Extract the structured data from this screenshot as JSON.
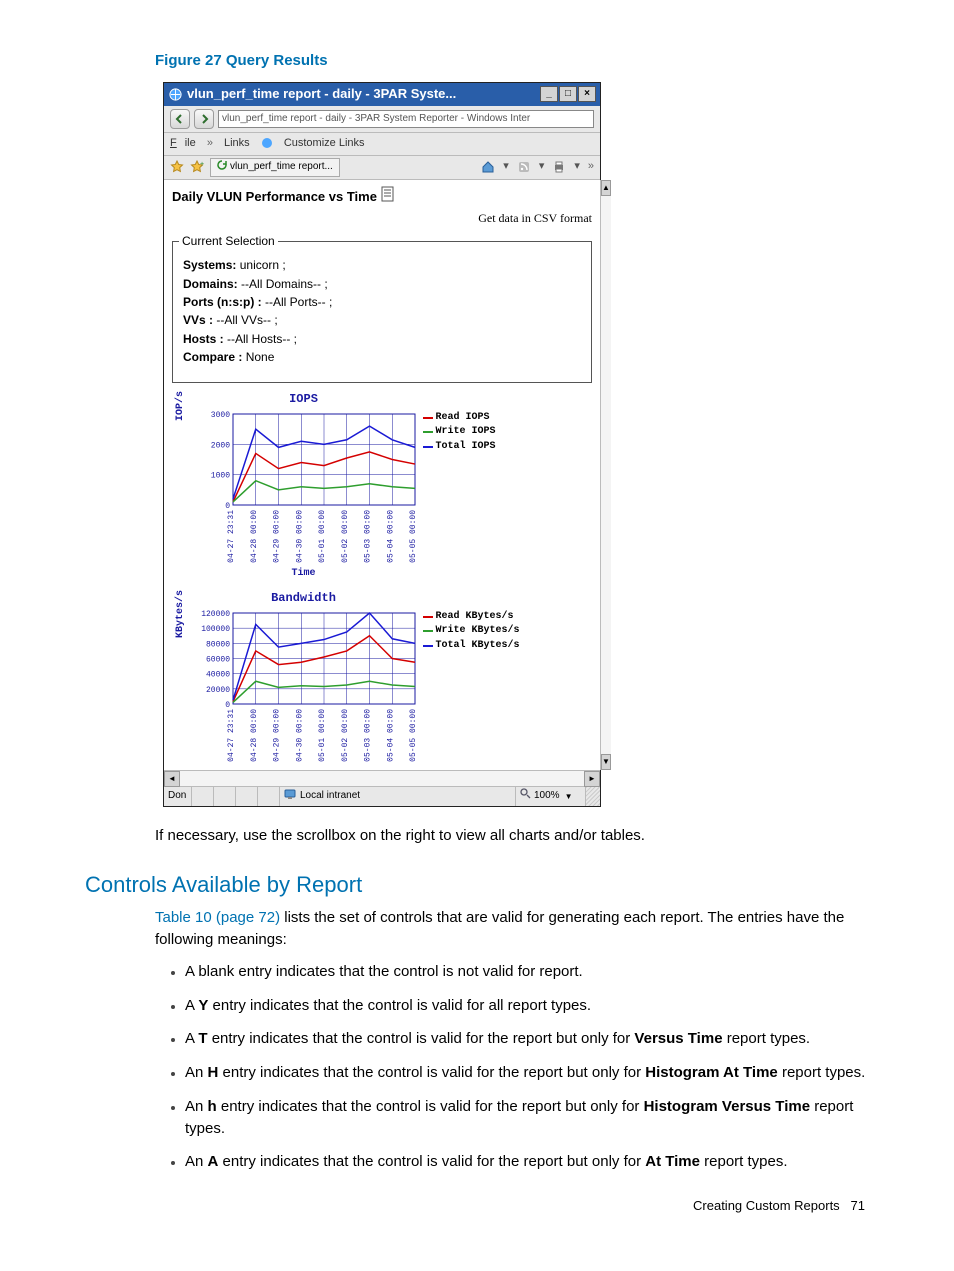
{
  "figure": {
    "caption": "Figure 27 Query Results",
    "window_title": "vlun_perf_time report - daily - 3PAR Syste...",
    "address_bar": "vlun_perf_time report - daily - 3PAR System Reporter - Windows Inter",
    "menu_file": "File",
    "menu_links": "Links",
    "menu_custom": "Customize Links",
    "tab_label": "vlun_perf_time report...",
    "content_title": "Daily VLUN Performance vs Time",
    "csv_link": "Get data in CSV format",
    "legend_label": "Current Selection",
    "selection": {
      "systems_label": "Systems:",
      "systems_value": "unicorn ;",
      "domains_label": "Domains:",
      "domains_value": "--All Domains-- ;",
      "ports_label": "Ports (n:s:p) :",
      "ports_value": "--All Ports-- ;",
      "vvs_label": "VVs :",
      "vvs_value": "--All VVs-- ;",
      "hosts_label": "Hosts :",
      "hosts_value": "--All Hosts-- ;",
      "compare_label": "Compare :",
      "compare_value": "None"
    },
    "iops_chart": {
      "title": "IOPS",
      "ylabel": "IOP/s",
      "xlabel": "Time"
    },
    "bw_chart": {
      "title": "Bandwidth",
      "ylabel": "KBytes/s"
    },
    "legend_iops": {
      "read": "Read IOPS",
      "write": "Write IOPS",
      "total": "Total IOPS"
    },
    "legend_bw": {
      "read": "Read KBytes/s",
      "write": "Write KBytes/s",
      "total": "Total KBytes/s"
    },
    "status_left": "Don",
    "status_intranet": "Local intranet",
    "status_zoom": "100%"
  },
  "chart_data": [
    {
      "type": "line",
      "title": "IOPS",
      "ylabel": "IOP/s",
      "xlabel": "Time",
      "ylim": [
        0,
        3000
      ],
      "y_ticks": [
        0,
        1000,
        2000,
        3000
      ],
      "categories": [
        "04-27 23:31",
        "04-28 00:00",
        "04-29 00:00",
        "04-30 00:00",
        "05-01 00:00",
        "05-02 00:00",
        "05-03 00:00",
        "05-04 00:00",
        "05-05 00:00"
      ],
      "series": [
        {
          "name": "Read IOPS",
          "color": "#d40000",
          "values": [
            100,
            1700,
            1200,
            1400,
            1300,
            1550,
            1750,
            1500,
            1350
          ]
        },
        {
          "name": "Write IOPS",
          "color": "#2e9e2e",
          "values": [
            100,
            800,
            500,
            600,
            550,
            600,
            700,
            600,
            550
          ]
        },
        {
          "name": "Total IOPS",
          "color": "#1a1ad4",
          "values": [
            200,
            2500,
            1900,
            2100,
            2000,
            2150,
            2600,
            2150,
            1900
          ]
        }
      ]
    },
    {
      "type": "line",
      "title": "Bandwidth",
      "ylabel": "KBytes/s",
      "xlabel": "Time",
      "ylim": [
        0,
        120000
      ],
      "y_ticks": [
        0,
        20000,
        40000,
        60000,
        80000,
        100000,
        120000
      ],
      "categories": [
        "04-27 23:31",
        "04-28 00:00",
        "04-29 00:00",
        "04-30 00:00",
        "05-01 00:00",
        "05-02 00:00",
        "05-03 00:00",
        "05-04 00:00",
        "05-05 00:00"
      ],
      "series": [
        {
          "name": "Read KBytes/s",
          "color": "#d40000",
          "values": [
            3000,
            70000,
            52000,
            55000,
            62000,
            70000,
            90000,
            60000,
            55000
          ]
        },
        {
          "name": "Write KBytes/s",
          "color": "#2e9e2e",
          "values": [
            2000,
            30000,
            22000,
            24000,
            23000,
            25000,
            30000,
            25000,
            23000
          ]
        },
        {
          "name": "Total KBytes/s",
          "color": "#1a1ad4",
          "values": [
            5000,
            105000,
            75000,
            80000,
            85000,
            95000,
            120000,
            86000,
            80000
          ]
        }
      ]
    }
  ],
  "body": {
    "after_figure": "If necessary, use the scrollbox on the right to view all charts and/or tables.",
    "section_heading": "Controls Available by Report",
    "para_ref": "Table 10 (page 72)",
    "para_rest": " lists the set of controls that are valid for generating each report. The entries have the following meanings:",
    "bullet1": "A blank entry indicates that the control is not valid for report.",
    "bullet2_pre": "A ",
    "bullet2_b": "Y",
    "bullet2_post": " entry indicates that the control is valid for all report types.",
    "bullet3_pre": "A ",
    "bullet3_b": "T",
    "bullet3_mid": " entry indicates that the control is valid for the report but only for ",
    "bullet3_b2": "Versus Time",
    "bullet3_post": " report types.",
    "bullet4_pre": "An ",
    "bullet4_b": "H",
    "bullet4_mid": " entry indicates that the control is valid for the report but only for ",
    "bullet4_b2": "Histogram At Time",
    "bullet4_post": " report types.",
    "bullet5_pre": "An ",
    "bullet5_b": "h",
    "bullet5_mid": " entry indicates that the control is valid for the report but only for ",
    "bullet5_b2": "Histogram Versus Time",
    "bullet5_post": " report types.",
    "bullet6_pre": "An ",
    "bullet6_b": "A",
    "bullet6_mid": " entry indicates that the control is valid for the report but only for ",
    "bullet6_b2": "At Time",
    "bullet6_post": " report types."
  },
  "footer": {
    "text": "Creating Custom Reports",
    "page": "71"
  }
}
